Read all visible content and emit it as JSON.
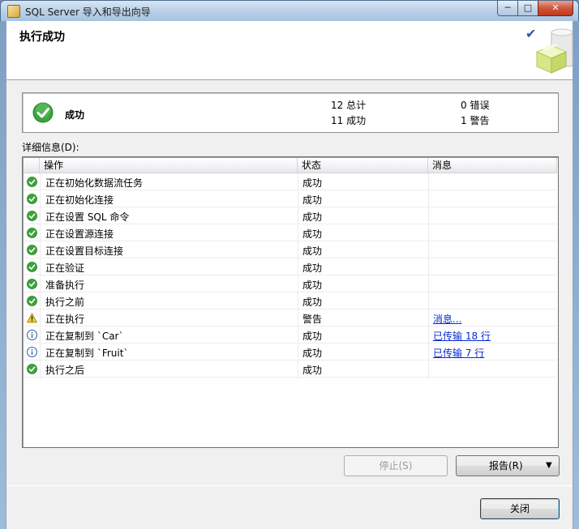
{
  "window": {
    "title": "SQL Server 导入和导出向导",
    "min_label": "─",
    "max_label": "□",
    "close_label": "✕"
  },
  "header": {
    "title": "执行成功"
  },
  "summary": {
    "status": "成功",
    "total": "12 总计",
    "success": "11 成功",
    "error": "0 错误",
    "warning": "1 警告"
  },
  "details": {
    "label": "详细信息(D):",
    "columns": {
      "action": "操作",
      "status": "状态",
      "message": "消息"
    },
    "rows": [
      {
        "icon": "success-icon",
        "action": "正在初始化数据流任务",
        "status": "成功",
        "message": ""
      },
      {
        "icon": "success-icon",
        "action": "正在初始化连接",
        "status": "成功",
        "message": ""
      },
      {
        "icon": "success-icon",
        "action": "正在设置 SQL 命令",
        "status": "成功",
        "message": ""
      },
      {
        "icon": "success-icon",
        "action": "正在设置源连接",
        "status": "成功",
        "message": ""
      },
      {
        "icon": "success-icon",
        "action": "正在设置目标连接",
        "status": "成功",
        "message": ""
      },
      {
        "icon": "success-icon",
        "action": "正在验证",
        "status": "成功",
        "message": ""
      },
      {
        "icon": "success-icon",
        "action": "准备执行",
        "status": "成功",
        "message": ""
      },
      {
        "icon": "success-icon",
        "action": "执行之前",
        "status": "成功",
        "message": ""
      },
      {
        "icon": "warning-icon",
        "action": "正在执行",
        "status": "警告",
        "message": "消息..."
      },
      {
        "icon": "info-icon",
        "action": "正在复制到 `Car`",
        "status": "成功",
        "message": "已传输 18 行"
      },
      {
        "icon": "info-icon",
        "action": "正在复制到 `Fruit`",
        "status": "成功",
        "message": "已传输 7 行"
      },
      {
        "icon": "success-icon",
        "action": "执行之后",
        "status": "成功",
        "message": ""
      }
    ]
  },
  "buttons": {
    "stop": "停止(S)",
    "report": "报告(R)",
    "report_arrow": "▼",
    "close": "关闭"
  },
  "colors": {
    "success": "#3aa53a",
    "warning": "#e8c21a",
    "info": "#2e5ea8",
    "link": "#0a2bd1"
  }
}
